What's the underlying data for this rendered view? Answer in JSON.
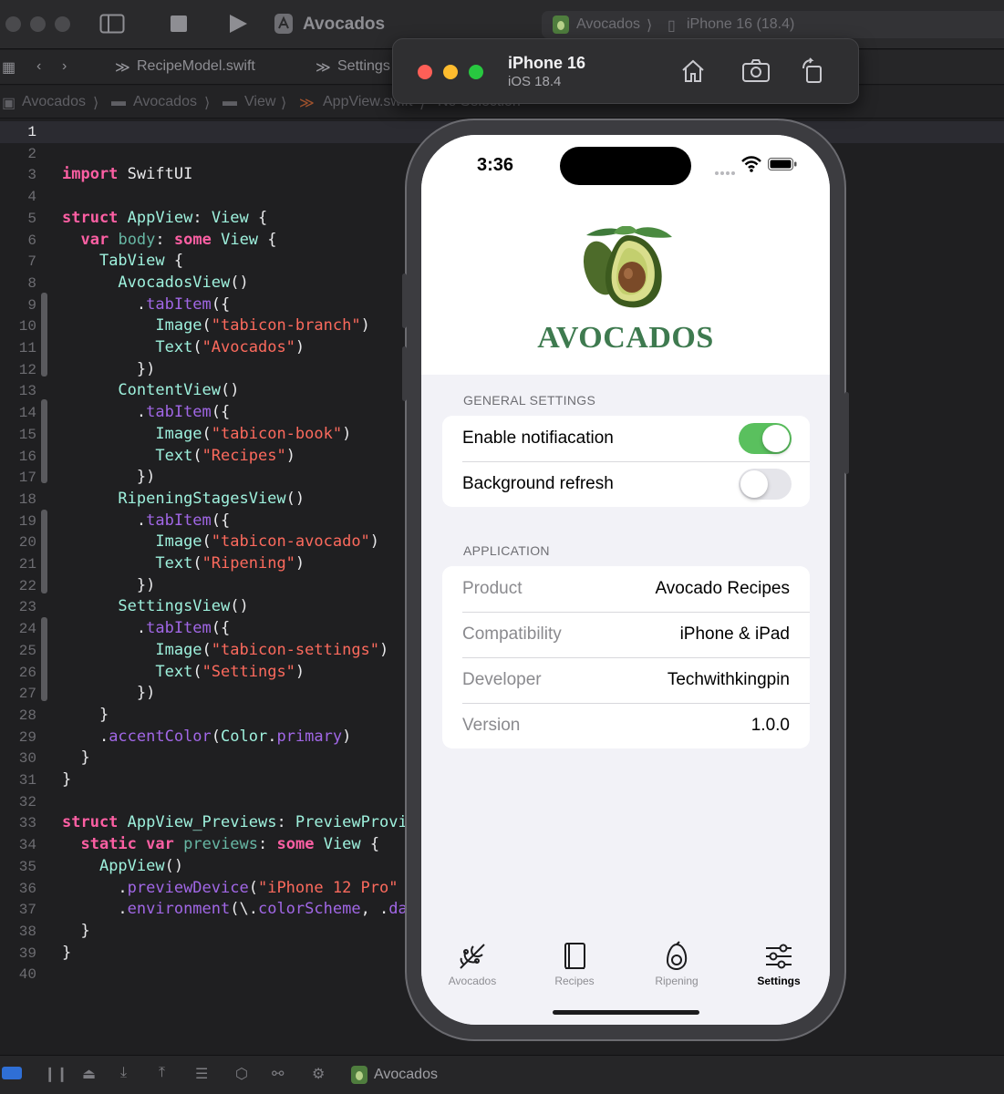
{
  "toolbar": {
    "project_title": "Avocados",
    "scheme_name": "Avocados",
    "device_target": "iPhone 16 (18.4)"
  },
  "editor_tabs": [
    "RecipeModel.swift",
    "Settings"
  ],
  "breadcrumb": [
    "Avocados",
    "Avocados",
    "View",
    "AppView.swift",
    "No Selection"
  ],
  "line_numbers": [
    "1",
    "2",
    "3",
    "4",
    "5",
    "6",
    "7",
    "8",
    "9",
    "10",
    "11",
    "12",
    "13",
    "14",
    "15",
    "16",
    "17",
    "18",
    "19",
    "20",
    "21",
    "22",
    "23",
    "24",
    "25",
    "26",
    "27",
    "28",
    "29",
    "30",
    "31",
    "32",
    "33",
    "34",
    "35",
    "36",
    "37",
    "38",
    "39",
    "40"
  ],
  "code_lines": [
    [],
    [],
    [
      {
        "t": "import",
        "c": "kw"
      },
      {
        "t": " SwiftUI",
        "c": "pl"
      }
    ],
    [],
    [
      {
        "t": "struct",
        "c": "kw"
      },
      {
        "t": " ",
        "c": "pl"
      },
      {
        "t": "AppView",
        "c": "ty"
      },
      {
        "t": ": ",
        "c": "pl"
      },
      {
        "t": "View",
        "c": "ty"
      },
      {
        "t": " {",
        "c": "pl"
      }
    ],
    [
      {
        "t": "  ",
        "c": "pl"
      },
      {
        "t": "var",
        "c": "kw"
      },
      {
        "t": " ",
        "c": "pl"
      },
      {
        "t": "body",
        "c": "fn"
      },
      {
        "t": ": ",
        "c": "pl"
      },
      {
        "t": "some",
        "c": "kw"
      },
      {
        "t": " ",
        "c": "pl"
      },
      {
        "t": "View",
        "c": "ty"
      },
      {
        "t": " {",
        "c": "pl"
      }
    ],
    [
      {
        "t": "    ",
        "c": "pl"
      },
      {
        "t": "TabView",
        "c": "ty"
      },
      {
        "t": " {",
        "c": "pl"
      }
    ],
    [
      {
        "t": "      ",
        "c": "pl"
      },
      {
        "t": "AvocadosView",
        "c": "ty"
      },
      {
        "t": "()",
        "c": "pl"
      }
    ],
    [
      {
        "t": "        .",
        "c": "pl"
      },
      {
        "t": "tabItem",
        "c": "pr"
      },
      {
        "t": "({",
        "c": "pl"
      }
    ],
    [
      {
        "t": "          ",
        "c": "pl"
      },
      {
        "t": "Image",
        "c": "ty"
      },
      {
        "t": "(",
        "c": "pl"
      },
      {
        "t": "\"tabicon-branch\"",
        "c": "st"
      },
      {
        "t": ")",
        "c": "pl"
      }
    ],
    [
      {
        "t": "          ",
        "c": "pl"
      },
      {
        "t": "Text",
        "c": "ty"
      },
      {
        "t": "(",
        "c": "pl"
      },
      {
        "t": "\"Avocados\"",
        "c": "st"
      },
      {
        "t": ")",
        "c": "pl"
      }
    ],
    [
      {
        "t": "        })",
        "c": "pl"
      }
    ],
    [
      {
        "t": "      ",
        "c": "pl"
      },
      {
        "t": "ContentView",
        "c": "ty"
      },
      {
        "t": "()",
        "c": "pl"
      }
    ],
    [
      {
        "t": "        .",
        "c": "pl"
      },
      {
        "t": "tabItem",
        "c": "pr"
      },
      {
        "t": "({",
        "c": "pl"
      }
    ],
    [
      {
        "t": "          ",
        "c": "pl"
      },
      {
        "t": "Image",
        "c": "ty"
      },
      {
        "t": "(",
        "c": "pl"
      },
      {
        "t": "\"tabicon-book\"",
        "c": "st"
      },
      {
        "t": ")",
        "c": "pl"
      }
    ],
    [
      {
        "t": "          ",
        "c": "pl"
      },
      {
        "t": "Text",
        "c": "ty"
      },
      {
        "t": "(",
        "c": "pl"
      },
      {
        "t": "\"Recipes\"",
        "c": "st"
      },
      {
        "t": ")",
        "c": "pl"
      }
    ],
    [
      {
        "t": "        })",
        "c": "pl"
      }
    ],
    [
      {
        "t": "      ",
        "c": "pl"
      },
      {
        "t": "RipeningStagesView",
        "c": "ty"
      },
      {
        "t": "()",
        "c": "pl"
      }
    ],
    [
      {
        "t": "        .",
        "c": "pl"
      },
      {
        "t": "tabItem",
        "c": "pr"
      },
      {
        "t": "({",
        "c": "pl"
      }
    ],
    [
      {
        "t": "          ",
        "c": "pl"
      },
      {
        "t": "Image",
        "c": "ty"
      },
      {
        "t": "(",
        "c": "pl"
      },
      {
        "t": "\"tabicon-avocado\"",
        "c": "st"
      },
      {
        "t": ")",
        "c": "pl"
      }
    ],
    [
      {
        "t": "          ",
        "c": "pl"
      },
      {
        "t": "Text",
        "c": "ty"
      },
      {
        "t": "(",
        "c": "pl"
      },
      {
        "t": "\"Ripening\"",
        "c": "st"
      },
      {
        "t": ")",
        "c": "pl"
      }
    ],
    [
      {
        "t": "        })",
        "c": "pl"
      }
    ],
    [
      {
        "t": "      ",
        "c": "pl"
      },
      {
        "t": "SettingsView",
        "c": "ty"
      },
      {
        "t": "()",
        "c": "pl"
      }
    ],
    [
      {
        "t": "        .",
        "c": "pl"
      },
      {
        "t": "tabItem",
        "c": "pr"
      },
      {
        "t": "({",
        "c": "pl"
      }
    ],
    [
      {
        "t": "          ",
        "c": "pl"
      },
      {
        "t": "Image",
        "c": "ty"
      },
      {
        "t": "(",
        "c": "pl"
      },
      {
        "t": "\"tabicon-settings\"",
        "c": "st"
      },
      {
        "t": ")",
        "c": "pl"
      }
    ],
    [
      {
        "t": "          ",
        "c": "pl"
      },
      {
        "t": "Text",
        "c": "ty"
      },
      {
        "t": "(",
        "c": "pl"
      },
      {
        "t": "\"Settings\"",
        "c": "st"
      },
      {
        "t": ")",
        "c": "pl"
      }
    ],
    [
      {
        "t": "        })",
        "c": "pl"
      }
    ],
    [
      {
        "t": "    }",
        "c": "pl"
      }
    ],
    [
      {
        "t": "    .",
        "c": "pl"
      },
      {
        "t": "accentColor",
        "c": "pr"
      },
      {
        "t": "(",
        "c": "pl"
      },
      {
        "t": "Color",
        "c": "ty"
      },
      {
        "t": ".",
        "c": "pl"
      },
      {
        "t": "primary",
        "c": "pr"
      },
      {
        "t": ")",
        "c": "pl"
      }
    ],
    [
      {
        "t": "  }",
        "c": "pl"
      }
    ],
    [
      {
        "t": "}",
        "c": "pl"
      }
    ],
    [],
    [
      {
        "t": "struct",
        "c": "kw"
      },
      {
        "t": " ",
        "c": "pl"
      },
      {
        "t": "AppView_Previews",
        "c": "ty"
      },
      {
        "t": ": ",
        "c": "pl"
      },
      {
        "t": "PreviewProvi",
        "c": "ty"
      }
    ],
    [
      {
        "t": "  ",
        "c": "pl"
      },
      {
        "t": "static",
        "c": "kw"
      },
      {
        "t": " ",
        "c": "pl"
      },
      {
        "t": "var",
        "c": "kw"
      },
      {
        "t": " ",
        "c": "pl"
      },
      {
        "t": "previews",
        "c": "fn"
      },
      {
        "t": ": ",
        "c": "pl"
      },
      {
        "t": "some",
        "c": "kw"
      },
      {
        "t": " ",
        "c": "pl"
      },
      {
        "t": "View",
        "c": "ty"
      },
      {
        "t": " {",
        "c": "pl"
      }
    ],
    [
      {
        "t": "    ",
        "c": "pl"
      },
      {
        "t": "AppView",
        "c": "ty"
      },
      {
        "t": "()",
        "c": "pl"
      }
    ],
    [
      {
        "t": "      .",
        "c": "pl"
      },
      {
        "t": "previewDevice",
        "c": "pr"
      },
      {
        "t": "(",
        "c": "pl"
      },
      {
        "t": "\"iPhone 12 Pro\"",
        "c": "st"
      }
    ],
    [
      {
        "t": "      .",
        "c": "pl"
      },
      {
        "t": "environment",
        "c": "pr"
      },
      {
        "t": "(\\.",
        "c": "pl"
      },
      {
        "t": "colorScheme",
        "c": "pr"
      },
      {
        "t": ", .",
        "c": "pl"
      },
      {
        "t": "da",
        "c": "pr"
      }
    ],
    [
      {
        "t": "  }",
        "c": "pl"
      }
    ],
    [
      {
        "t": "}",
        "c": "pl"
      }
    ],
    []
  ],
  "simulator": {
    "device_name": "iPhone 16",
    "os_version": "iOS 18.4"
  },
  "phone": {
    "time": "3:36",
    "brand": "AVOCADOS",
    "general_header": "GENERAL SETTINGS",
    "general_rows": [
      {
        "label": "Enable notifiacation",
        "on": true
      },
      {
        "label": "Background refresh",
        "on": false
      }
    ],
    "app_header": "APPLICATION",
    "app_rows": [
      {
        "label": "Product",
        "value": "Avocado Recipes"
      },
      {
        "label": "Compatibility",
        "value": "iPhone & iPad"
      },
      {
        "label": "Developer",
        "value": "Techwithkingpin"
      },
      {
        "label": "Version",
        "value": "1.0.0"
      }
    ],
    "tabs": [
      {
        "label": "Avocados",
        "icon": "branch-icon",
        "active": false
      },
      {
        "label": "Recipes",
        "icon": "book-icon",
        "active": false
      },
      {
        "label": "Ripening",
        "icon": "avocado-icon",
        "active": false
      },
      {
        "label": "Settings",
        "icon": "sliders-icon",
        "active": true
      }
    ]
  },
  "statusbar": {
    "scheme_label": "Avocados"
  },
  "colors": {
    "toggle_on": "#5ac05e",
    "toggle_off": "#e5e5ea",
    "brand_green": "#3e7a4f",
    "accent_blue": "#2f6fd6"
  }
}
